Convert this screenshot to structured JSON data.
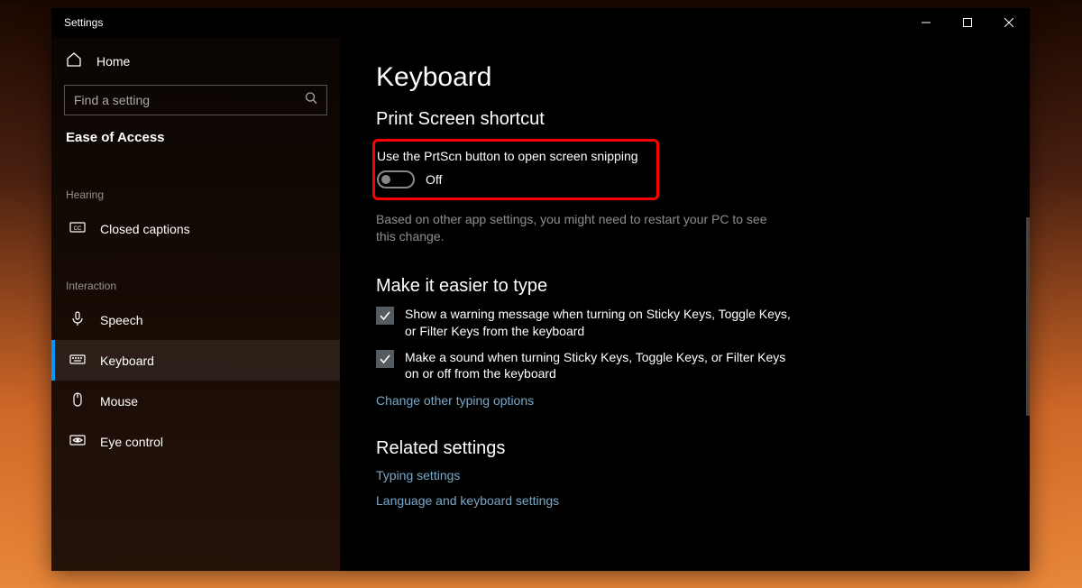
{
  "window": {
    "title": "Settings"
  },
  "sidebar": {
    "home_label": "Home",
    "search": {
      "placeholder": "Find a setting"
    },
    "category": "Ease of Access",
    "groups": [
      {
        "label": "Hearing",
        "items": [
          {
            "id": "closed-captions",
            "label": "Closed captions",
            "icon": "cc"
          }
        ]
      },
      {
        "label": "Interaction",
        "items": [
          {
            "id": "speech",
            "label": "Speech",
            "icon": "mic"
          },
          {
            "id": "keyboard",
            "label": "Keyboard",
            "icon": "keyboard",
            "active": true
          },
          {
            "id": "mouse",
            "label": "Mouse",
            "icon": "mouse"
          },
          {
            "id": "eye-control",
            "label": "Eye control",
            "icon": "eye"
          }
        ]
      }
    ]
  },
  "content": {
    "title": "Keyboard",
    "section_prtscn": {
      "heading": "Print Screen shortcut",
      "toggle_label": "Use the PrtScn button to open screen snipping",
      "toggle_state": "Off",
      "hint": "Based on other app settings, you might need to restart your PC to see this change."
    },
    "section_easier": {
      "heading": "Make it easier to type",
      "check1": "Show a warning message when turning on Sticky Keys, Toggle Keys, or Filter Keys from the keyboard",
      "check2": "Make a sound when turning Sticky Keys, Toggle Keys, or Filter Keys on or off from the keyboard",
      "link_change": "Change other typing options"
    },
    "section_related": {
      "heading": "Related settings",
      "link_typing": "Typing settings",
      "link_lang": "Language and keyboard settings"
    }
  }
}
